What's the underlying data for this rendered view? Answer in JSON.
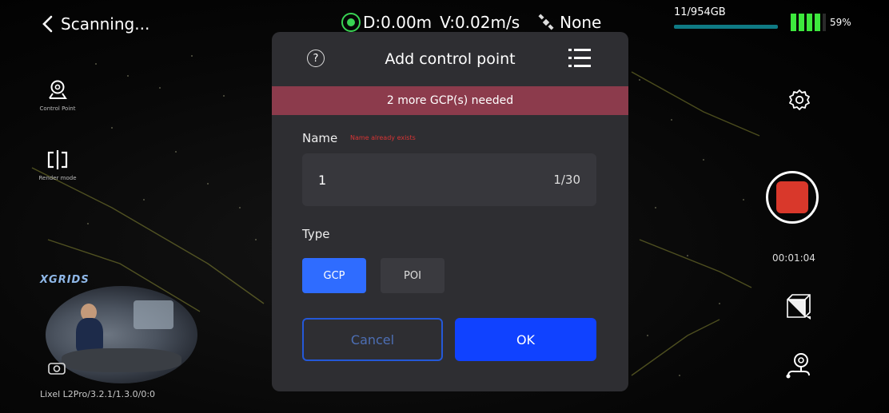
{
  "header": {
    "back_label": "Scanning...",
    "distance": "D:0.00m",
    "velocity": "V:0.02m/s",
    "satellite_status": "None",
    "storage": "11/954GB",
    "battery_percent": "59%",
    "battery_level": 0.59
  },
  "left_tools": [
    {
      "caption": "Control Point"
    },
    {
      "caption": "Render mode"
    }
  ],
  "camera": {
    "brand": "XGRIDS",
    "device_info": "Lixel L2Pro/3.2.1/1.3.0/0:0"
  },
  "right_tools": {
    "record_timer": "00:01:04"
  },
  "dialog": {
    "title": "Add control point",
    "help_glyph": "?",
    "alert": "2 more GCP(s) needed",
    "name_label": "Name",
    "name_hint": "Name already exists",
    "name_value": "1",
    "name_count": "1/30",
    "type_label": "Type",
    "type_options": [
      "GCP",
      "POI"
    ],
    "selected_type": "GCP",
    "cancel_label": "Cancel",
    "ok_label": "OK"
  },
  "colors": {
    "accent": "#1042ff",
    "selected_type": "#2f6cff",
    "alert_bg": "#8c3b4c",
    "record": "#d9382b",
    "status_ok": "#39d353",
    "battery": "#3de83d"
  }
}
